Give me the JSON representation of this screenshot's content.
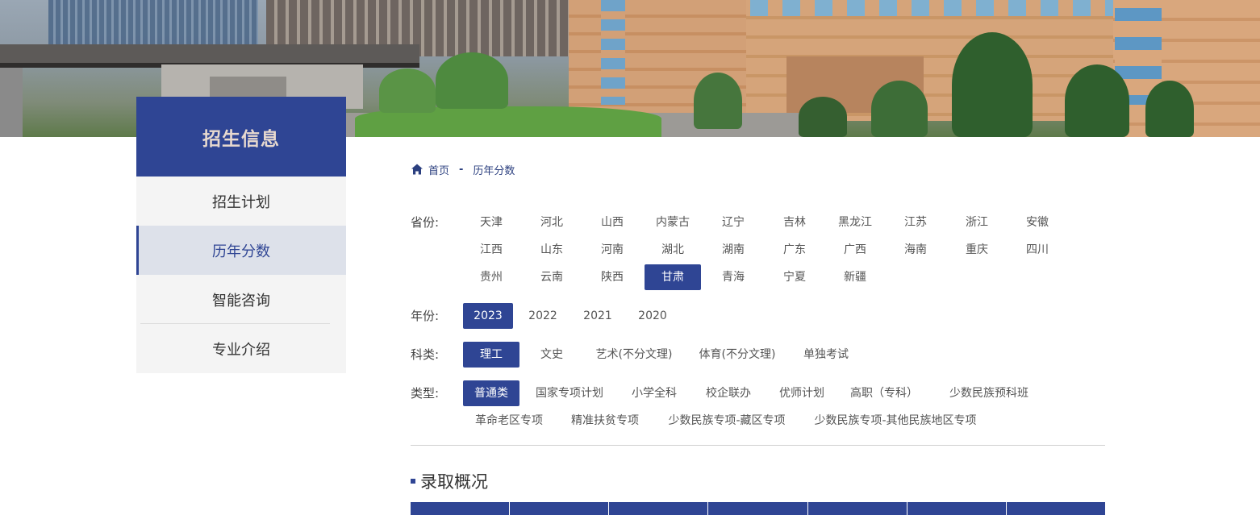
{
  "sidebar": {
    "title": "招生信息",
    "items": [
      {
        "label": "招生计划"
      },
      {
        "label": "历年分数"
      },
      {
        "label": "智能咨询"
      },
      {
        "label": "专业介绍"
      }
    ],
    "active_index": 1
  },
  "breadcrumb": {
    "home": "首页",
    "separator": "-",
    "current": "历年分数"
  },
  "filters": {
    "province": {
      "label": "省份:",
      "options": [
        "天津",
        "河北",
        "山西",
        "内蒙古",
        "辽宁",
        "吉林",
        "黑龙江",
        "江苏",
        "浙江",
        "安徽",
        "江西",
        "山东",
        "河南",
        "湖北",
        "湖南",
        "广东",
        "广西",
        "海南",
        "重庆",
        "四川",
        "贵州",
        "云南",
        "陕西",
        "甘肃",
        "青海",
        "宁夏",
        "新疆"
      ],
      "selected": "甘肃"
    },
    "year": {
      "label": "年份:",
      "options": [
        "2023",
        "2022",
        "2021",
        "2020"
      ],
      "selected": "2023"
    },
    "category": {
      "label": "科类:",
      "options": [
        "理工",
        "文史",
        "艺术(不分文理)",
        "体育(不分文理)",
        "单独考试"
      ],
      "selected": "理工"
    },
    "type": {
      "label": "类型:",
      "options": [
        "普通类",
        "国家专项计划",
        "小学全科",
        "校企联办",
        "优师计划",
        "高职（专科）",
        "少数民族预科班",
        "革命老区专项",
        "精准扶贫专项",
        "少数民族专项-藏区专项",
        "少数民族专项-其他民族地区专项"
      ],
      "selected": "普通类"
    }
  },
  "section": {
    "title": "录取概况"
  },
  "colors": {
    "accent": "#2f4594",
    "sidebar_active_bg": "#dde1ea",
    "sidebar_bg": "#f4f4f4"
  },
  "icons": {
    "breadcrumb_home": "home-icon"
  }
}
